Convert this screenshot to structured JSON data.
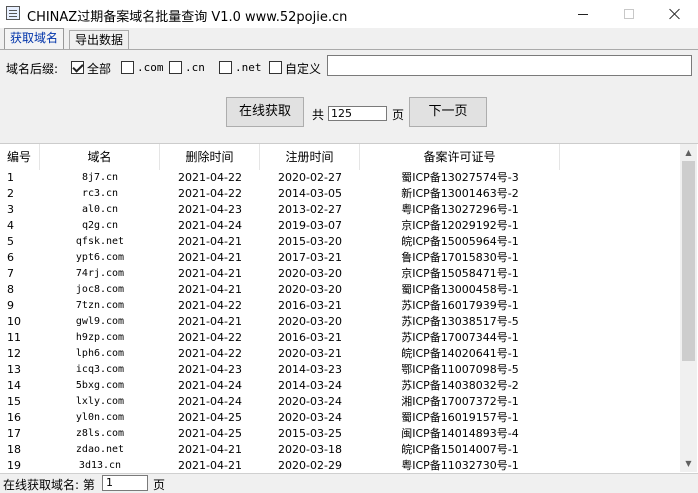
{
  "window": {
    "title": "CHINAZ过期备案域名批量查询 V1.0 www.52pojie.cn",
    "minimize": "—",
    "maximize": "☐",
    "close": "✕"
  },
  "tabs": [
    {
      "label": "获取域名",
      "active": true
    },
    {
      "label": "导出数据",
      "active": false
    }
  ],
  "filters": {
    "label": "域名后缀:",
    "options": [
      {
        "label": "全部",
        "checked": true
      },
      {
        "label": ".com",
        "checked": false
      },
      {
        "label": ".cn",
        "checked": false
      },
      {
        "label": ".net",
        "checked": false
      },
      {
        "label": "自定义",
        "checked": false
      }
    ],
    "custom_value": ""
  },
  "paging": {
    "fetch_button": "在线获取",
    "total_prefix": "共",
    "total_pages": "125",
    "page_unit": "页",
    "next_button": "下一页"
  },
  "table": {
    "headers": [
      "编号",
      "域名",
      "删除时间",
      "注册时间",
      "备案许可证号"
    ],
    "rows": [
      [
        "1",
        "8j7.cn",
        "2021-04-22",
        "2020-02-27",
        "蜀ICP备13027574号-3"
      ],
      [
        "2",
        "rc3.cn",
        "2021-04-22",
        "2014-03-05",
        "新ICP备13001463号-2"
      ],
      [
        "3",
        "al0.cn",
        "2021-04-23",
        "2013-02-27",
        "粤ICP备13027296号-1"
      ],
      [
        "4",
        "q2g.cn",
        "2021-04-24",
        "2019-03-07",
        "京ICP备12029192号-1"
      ],
      [
        "5",
        "qfsk.net",
        "2021-04-21",
        "2015-03-20",
        "皖ICP备15005964号-1"
      ],
      [
        "6",
        "ypt6.com",
        "2021-04-21",
        "2017-03-21",
        "鲁ICP备17015830号-1"
      ],
      [
        "7",
        "74rj.com",
        "2021-04-21",
        "2020-03-20",
        "京ICP备15058471号-1"
      ],
      [
        "8",
        "joc8.com",
        "2021-04-21",
        "2020-03-20",
        "蜀ICP备13000458号-1"
      ],
      [
        "9",
        "7tzn.com",
        "2021-04-22",
        "2016-03-21",
        "苏ICP备16017939号-1"
      ],
      [
        "10",
        "gwl9.com",
        "2021-04-21",
        "2020-03-20",
        "苏ICP备13038517号-5"
      ],
      [
        "11",
        "h9zp.com",
        "2021-04-22",
        "2016-03-21",
        "苏ICP备17007344号-1"
      ],
      [
        "12",
        "lph6.com",
        "2021-04-22",
        "2020-03-21",
        "皖ICP备14020641号-1"
      ],
      [
        "13",
        "icq3.com",
        "2021-04-23",
        "2014-03-23",
        "鄂ICP备11007098号-5"
      ],
      [
        "14",
        "5bxg.com",
        "2021-04-24",
        "2014-03-24",
        "苏ICP备14038032号-2"
      ],
      [
        "15",
        "lxly.com",
        "2021-04-24",
        "2020-03-24",
        "湘ICP备17007372号-1"
      ],
      [
        "16",
        "yl0n.com",
        "2021-04-25",
        "2020-03-24",
        "蜀ICP备16019157号-1"
      ],
      [
        "17",
        "z8ls.com",
        "2021-04-25",
        "2015-03-25",
        "闽ICP备14014893号-4"
      ],
      [
        "18",
        "zdao.net",
        "2021-04-21",
        "2020-03-18",
        "皖ICP备15014007号-1"
      ],
      [
        "19",
        "3d13.cn",
        "2021-04-21",
        "2020-02-29",
        "粤ICP备11032730号-1"
      ]
    ]
  },
  "status": {
    "prefix": "在线获取域名: 第",
    "page_value": "1",
    "suffix": "页"
  }
}
